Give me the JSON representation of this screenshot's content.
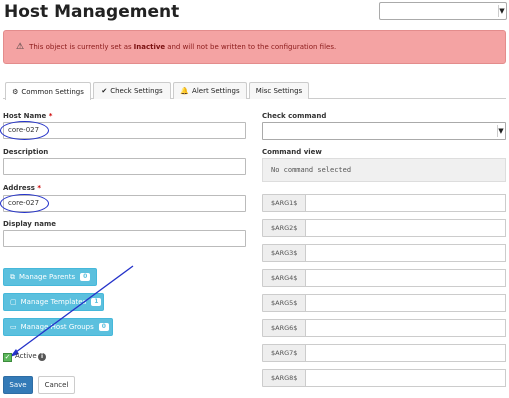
{
  "page_title": "Host Management",
  "alert": {
    "prefix": "This object is currently set as",
    "status": "Inactive",
    "suffix": "and will not be written to the configuration files."
  },
  "tabs": [
    {
      "label": "Common Settings",
      "icon": "gear-icon",
      "active": true
    },
    {
      "label": "Check Settings",
      "icon": "checkmark-icon",
      "active": false
    },
    {
      "label": "Alert Settings",
      "icon": "bell-icon",
      "active": false
    },
    {
      "label": "Misc Settings",
      "icon": "",
      "active": false
    }
  ],
  "form": {
    "host_name": {
      "label": "Host Name",
      "required_mark": "*",
      "value": "core-027"
    },
    "description": {
      "label": "Description",
      "value": ""
    },
    "address": {
      "label": "Address",
      "required_mark": "*",
      "value": "core-027"
    },
    "display_name": {
      "label": "Display name",
      "value": ""
    }
  },
  "buttons": {
    "manage_parents": {
      "label": "Manage Parents",
      "count": "0"
    },
    "manage_templates": {
      "label": "Manage Templates",
      "count": "1"
    },
    "manage_host_groups": {
      "label": "Manage Host Groups",
      "count": "0"
    },
    "save": "Save",
    "cancel": "Cancel"
  },
  "active_checkbox": {
    "label": "Active",
    "checked": true
  },
  "check_command": {
    "label": "Check command",
    "value": ""
  },
  "command_view": {
    "label": "Command view",
    "text": "No command selected"
  },
  "args": [
    "$ARG1$",
    "$ARG2$",
    "$ARG3$",
    "$ARG4$",
    "$ARG5$",
    "$ARG6$",
    "$ARG7$",
    "$ARG8$"
  ],
  "colors": {
    "alert_bg": "#f4a3a3",
    "info_button": "#5bc0de",
    "primary_button": "#337ab7",
    "annotation": "#2432c9"
  }
}
